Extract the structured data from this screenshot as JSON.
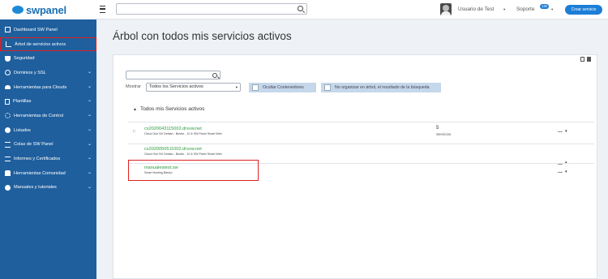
{
  "brand": {
    "name": "swpanel"
  },
  "header": {
    "search_placeholder": "",
    "user_name": "Usuario de Test",
    "user_caret": "▾",
    "support_label": "Soporte",
    "support_badge": "140",
    "support_caret": "▾",
    "create_button": "Crear servicio"
  },
  "sidebar": {
    "items": [
      {
        "label": "Dashboard SW Panel",
        "icon": "grid-icon",
        "chevron": ""
      },
      {
        "label": "Árbol de servicios activos",
        "icon": "tree-icon",
        "chevron": "",
        "active": true
      },
      {
        "label": "Seguridad",
        "icon": "shield-icon",
        "chevron": ""
      },
      {
        "label": "Dominios y SSL",
        "icon": "globe-icon",
        "chevron": "⌄"
      },
      {
        "label": "Herramientas para Clouds",
        "icon": "cloud-icon",
        "chevron": "⌄"
      },
      {
        "label": "Plantillas",
        "icon": "page-icon",
        "chevron": "⌄"
      },
      {
        "label": "Herramientas de Control",
        "icon": "gear-icon",
        "chevron": "⌄"
      },
      {
        "label": "Listados",
        "icon": "check-icon",
        "chevron": "⌄"
      },
      {
        "label": "Colas de SW Panel",
        "icon": "list-icon",
        "chevron": "⌄"
      },
      {
        "label": "Informes y Certificados",
        "icon": "stack-icon",
        "chevron": "⌄"
      },
      {
        "label": "Herramientas Comunidad",
        "icon": "users-icon",
        "chevron": "⌄"
      },
      {
        "label": "Manuales y tutoriales",
        "icon": "help-icon",
        "chevron": "⌄"
      }
    ]
  },
  "main": {
    "title": "Árbol con todos mis servicios activos",
    "filter": {
      "search_placeholder": "",
      "show_label": "Mostrar",
      "select_value": "Todos los Servicios activos",
      "toggle_hide_containers": "Ocultar Contenedores",
      "toggle_no_tree": "No organizar en árbol, el resultado de la búsqueda"
    },
    "tree": {
      "heading": "Todos mis Servicios activos",
      "rows": [
        {
          "name": "cs2020043115002.drsvw.net",
          "desc": "Cloud One NV Debian - Buster - 10 & SW Panel Smart Web",
          "count": "5",
          "count_label": "Servicios",
          "expander": "▷"
        },
        {
          "name": "cs2020050511002.drsvw.net",
          "desc": "Cloud One NV Debian - Buster - 10 & SW Panel Smart Web"
        },
        {
          "name": "manualestest.sw",
          "desc": "Smart Hosting Básico"
        }
      ]
    }
  },
  "row_actions": {
    "dots": "...",
    "caret": "▾"
  },
  "colors": {
    "sidebar": "#1f5f9e",
    "accent": "#1c7ed6",
    "highlight": "#e0201f",
    "link_green": "#2e9a3c"
  }
}
